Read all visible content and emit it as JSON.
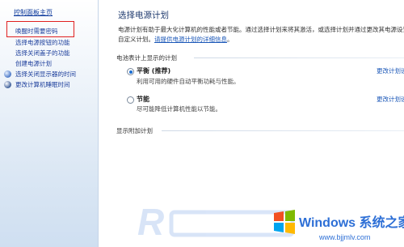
{
  "sidebar": {
    "home_link": "控制面板主页",
    "items": [
      {
        "label": "唤醒时需要密码",
        "icon": null
      },
      {
        "label": "选择电源按钮的功能",
        "icon": null
      },
      {
        "label": "选择关闭盖子的功能",
        "icon": null
      },
      {
        "label": "创建电源计划",
        "icon": null
      },
      {
        "label": "选择关闭显示器的时间",
        "icon": "monitor-icon"
      },
      {
        "label": "更改计算机睡眠时间",
        "icon": "sleep-moon-icon"
      }
    ]
  },
  "main": {
    "title": "选择电源计划",
    "desc_before": "电源计划有助于最大化计算机的性能或者节能。通过选择计划来将其激活，或选择计划并通过更改其电源设置来自定义计划。",
    "desc_link": "请提供电源计划的详细信息",
    "desc_after": "。",
    "battery_section": "电池表计上显示的计划",
    "plans": [
      {
        "name": "平衡 (推荐)",
        "desc": "利用可用的硬件自动平衡功耗与性能。",
        "settings": "更改计划设置",
        "selected": true
      },
      {
        "name": "节能",
        "desc": "尽可能降低计算机性能以节能。",
        "settings": "更改计划设置",
        "selected": false
      }
    ],
    "additional_section": "显示附加计划"
  },
  "watermark": {
    "brand_text": "Windows 系统之家",
    "site": "www.bjjmlv.com",
    "accent_color": "#2d6fd6"
  },
  "annotation": {
    "highlight_color": "#e02020"
  }
}
